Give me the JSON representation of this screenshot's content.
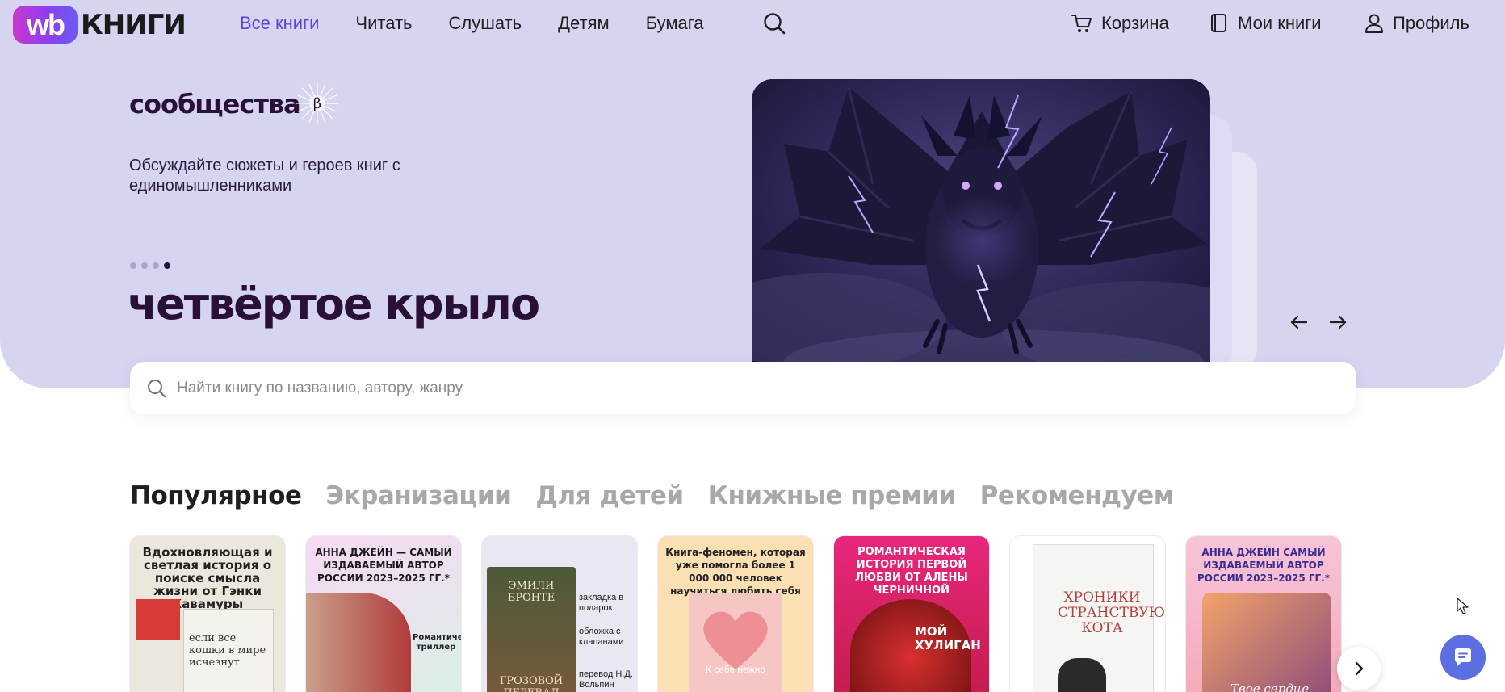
{
  "logo": {
    "badge": "wb",
    "text": "КНИГИ"
  },
  "nav": {
    "items": [
      "Все книги",
      "Читать",
      "Слушать",
      "Детям",
      "Бумага"
    ],
    "active_index": 0,
    "search_icon": "search-icon"
  },
  "right_nav": {
    "cart": "Корзина",
    "my_books": "Мои книги",
    "profile": "Профиль"
  },
  "hero": {
    "community_title": "сообщества",
    "community_badge": "β",
    "description": "Обсуждайте сюжеты и героев книг с единомышленниками",
    "title": "четвёртое крыло",
    "slides_total": 4,
    "slide_active": 4
  },
  "search": {
    "placeholder": "Найти книгу по названию, автору, жанру"
  },
  "tabs": {
    "items": [
      "Популярное",
      "Экранизации",
      "Для детей",
      "Книжные премии",
      "Рекомендуем"
    ],
    "active_index": 0
  },
  "books": [
    {
      "headline": "Вдохновляющая и светлая история о поиске смысла жизни от Гэнки Кавамуры",
      "cover_title": "если все кошки в мире исчезнут"
    },
    {
      "headline": "АННА ДЖЕЙН — САМЫЙ ИЗДАВАЕМЫЙ АВТОР РОССИИ 2023–2025 ГГ.*",
      "cover_title": "Романтический триллер"
    },
    {
      "headline": "ЭМИЛИ БРОНТЕ",
      "cover_title": "ГРОЗОВОЙ ПЕРЕВАЛ",
      "extras": [
        "закладка в подарок",
        "обложка с клапанами",
        "перевод Н.Д. Вольпин"
      ]
    },
    {
      "headline": "Книга-феномен, которая уже помогла более 1 000 000 человек научиться любить себя",
      "cover_title": "К себе нежно"
    },
    {
      "headline": "РОМАНТИЧЕСКАЯ ИСТОРИЯ ПЕРВОЙ ЛЮБВИ ОТ АЛЕНЫ ЧЕРНИЧНОЙ",
      "cover_title": "МОЙ ХУЛИГАН"
    },
    {
      "headline": "ХРОНИКИ СТРАНСТВУЮЩЕГО КОТА",
      "cover_title": "ХРОНИКИ СТРАНСТВУЮЩЕГО КОТА"
    },
    {
      "headline": "АННА ДЖЕЙН САМЫЙ ИЗДАВАЕМЫЙ АВТОР РОССИИ 2023–2025 ГГ.*",
      "cover_title": "Твое сердце будет"
    }
  ],
  "colors": {
    "hero_bg": "#d6d5f0",
    "accent": "#5b45d6",
    "title": "#2a0f36",
    "chat": "#5b6fe0"
  }
}
